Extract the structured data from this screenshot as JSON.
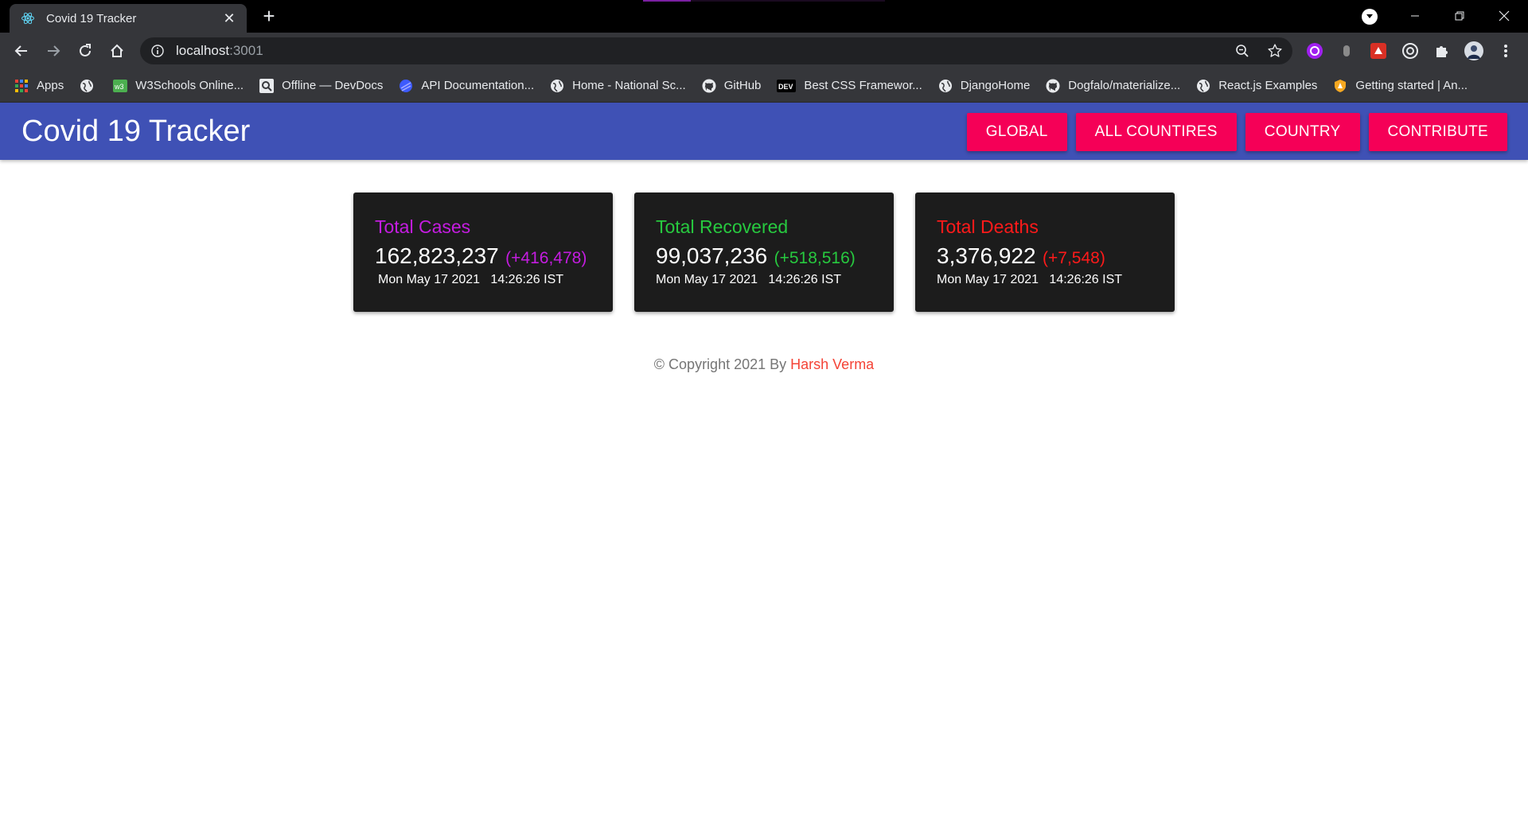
{
  "browser": {
    "tab_title": "Covid 19 Tracker",
    "url_host": "localhost",
    "url_port": ":3001",
    "bookmarks": [
      {
        "label": "Apps",
        "icon": "apps-grid-icon"
      },
      {
        "label": "",
        "icon": "globe-icon"
      },
      {
        "label": "W3Schools Online...",
        "icon": "w3schools-icon"
      },
      {
        "label": "Offline — DevDocs",
        "icon": "devdocs-icon"
      },
      {
        "label": "API Documentation...",
        "icon": "api-docs-icon"
      },
      {
        "label": "Home - National Sc...",
        "icon": "globe-icon"
      },
      {
        "label": "GitHub",
        "icon": "github-icon"
      },
      {
        "label": "Best CSS Framewor...",
        "icon": "dev-icon"
      },
      {
        "label": "DjangoHome",
        "icon": "globe-icon"
      },
      {
        "label": "Dogfalo/materialize...",
        "icon": "github-icon"
      },
      {
        "label": "React.js Examples",
        "icon": "globe-icon"
      },
      {
        "label": "Getting started | An...",
        "icon": "shield-icon"
      }
    ],
    "dev_badge": "DEV"
  },
  "app": {
    "brand": "Covid 19 Tracker",
    "nav": [
      "GLOBAL",
      "ALL COUNTIRES",
      "COUNTRY",
      "CONTRIBUTE"
    ]
  },
  "stats": [
    {
      "label": "Total Cases",
      "value": "162,823,237",
      "delta": "(+416,478)",
      "date": "Mon May 17 2021",
      "time": "14:26:26 IST",
      "color": "#c41ce0"
    },
    {
      "label": "Total Recovered",
      "value": "99,037,236",
      "delta": "(+518,516)",
      "date": "Mon May 17 2021",
      "time": "14:26:26 IST",
      "color": "#27c93f"
    },
    {
      "label": "Total Deaths",
      "value": "3,376,922",
      "delta": "(+7,548)",
      "date": "Mon May 17 2021",
      "time": "14:26:26 IST",
      "color": "#ff1a1a"
    }
  ],
  "footer": {
    "prefix": "© Copyright 2021 By",
    "author": "Harsh Verma"
  },
  "colors": {
    "appbar": "#3f51b5",
    "nav_button": "#f50057",
    "card_bg": "#1c1c1c",
    "author": "#f44336"
  }
}
